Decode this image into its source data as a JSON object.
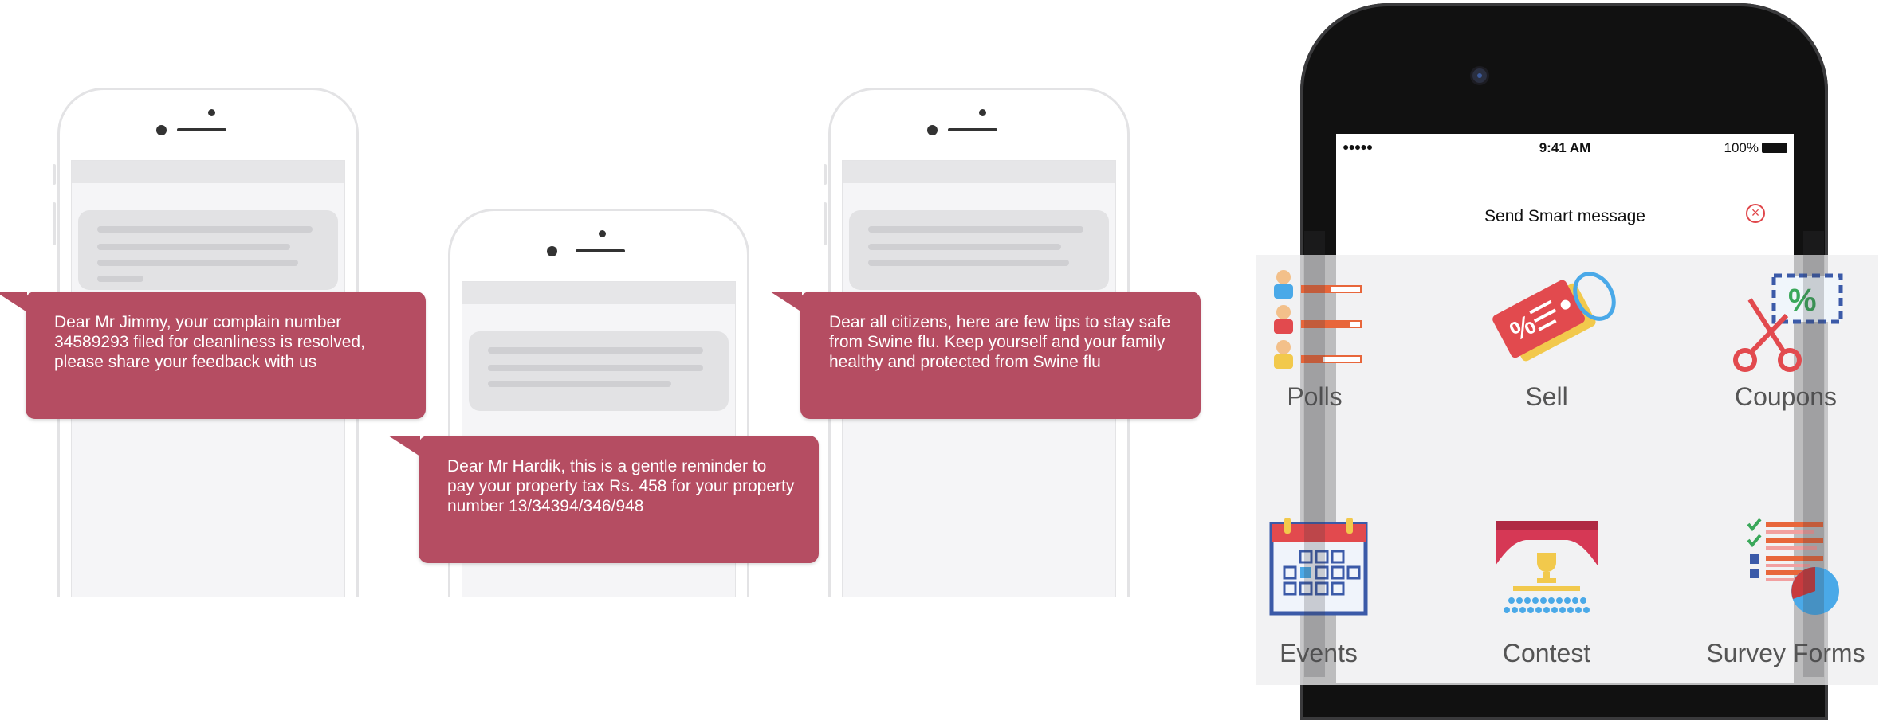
{
  "messages": [
    {
      "text": "Dear Mr Jimmy, your complain number 34589293 filed for cleanliness is resolved, please share your feedback with us"
    },
    {
      "text": "Dear Mr Hardik, this is a gentle reminder to pay your property tax Rs. 458 for your property number 13/34394/346/948"
    },
    {
      "text": "Dear all citizens, here are few tips to stay safe from Swine flu. Keep yourself and your family healthy and protected from Swine flu"
    }
  ],
  "phone": {
    "status_bar": {
      "signal": "●●●●● ",
      "time": "9:41 AM",
      "battery": "100%"
    },
    "title": "Send Smart message",
    "close_icon": "close-circle-icon",
    "features": [
      {
        "label": "Polls",
        "icon": "polls-icon"
      },
      {
        "label": "Sell",
        "icon": "price-tag-icon"
      },
      {
        "label": "Coupons",
        "icon": "coupon-scissors-icon"
      },
      {
        "label": "Events",
        "icon": "calendar-icon"
      },
      {
        "label": "Contest",
        "icon": "trophy-stage-icon"
      },
      {
        "label": "Survey Forms",
        "icon": "survey-chart-icon"
      }
    ]
  },
  "colors": {
    "bubble": "#b54d62",
    "accent_red": "#e0464a",
    "polls_bar": "#e8663a",
    "sell_tag": "#e24a4e",
    "calendar_blue": "#3b5aa8",
    "survey_blue": "#4aa9e8"
  }
}
